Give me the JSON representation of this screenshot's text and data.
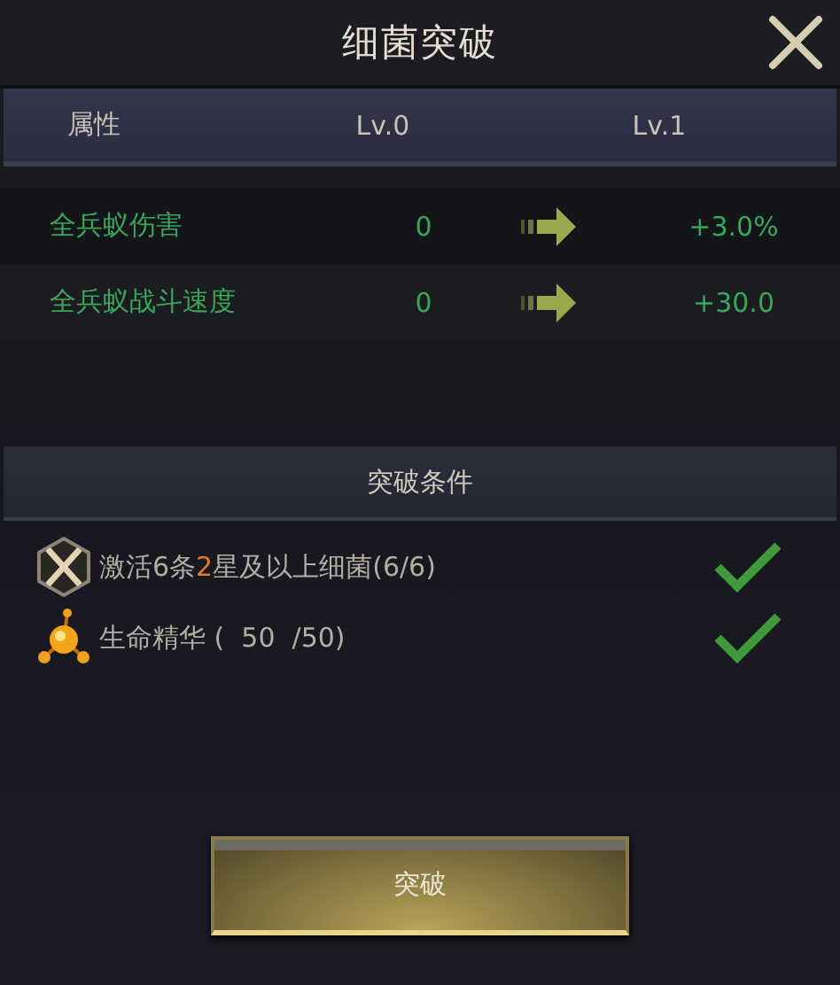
{
  "window": {
    "title": "细菌突破"
  },
  "table": {
    "columns": [
      "属性",
      "Lv.0",
      "Lv.1"
    ],
    "rows": [
      {
        "name": "全兵蚁伤害",
        "current": "0",
        "next": "+3.0%"
      },
      {
        "name": "全兵蚁战斗速度",
        "current": "0",
        "next": "+30.0"
      }
    ]
  },
  "conditions": {
    "title": "突破条件",
    "items": [
      {
        "kind": "swords",
        "parts": [
          {
            "text": "激活6条",
            "highlight": false
          },
          {
            "text": "2",
            "highlight": true
          },
          {
            "text": "星及以上细菌(6/6)",
            "highlight": false
          }
        ],
        "met": true
      },
      {
        "kind": "orb",
        "parts": [
          {
            "text": "生命精华 (  50  /50)",
            "highlight": false
          }
        ],
        "met": true
      }
    ]
  },
  "buttons": [
    {
      "label": "突破"
    }
  ]
}
